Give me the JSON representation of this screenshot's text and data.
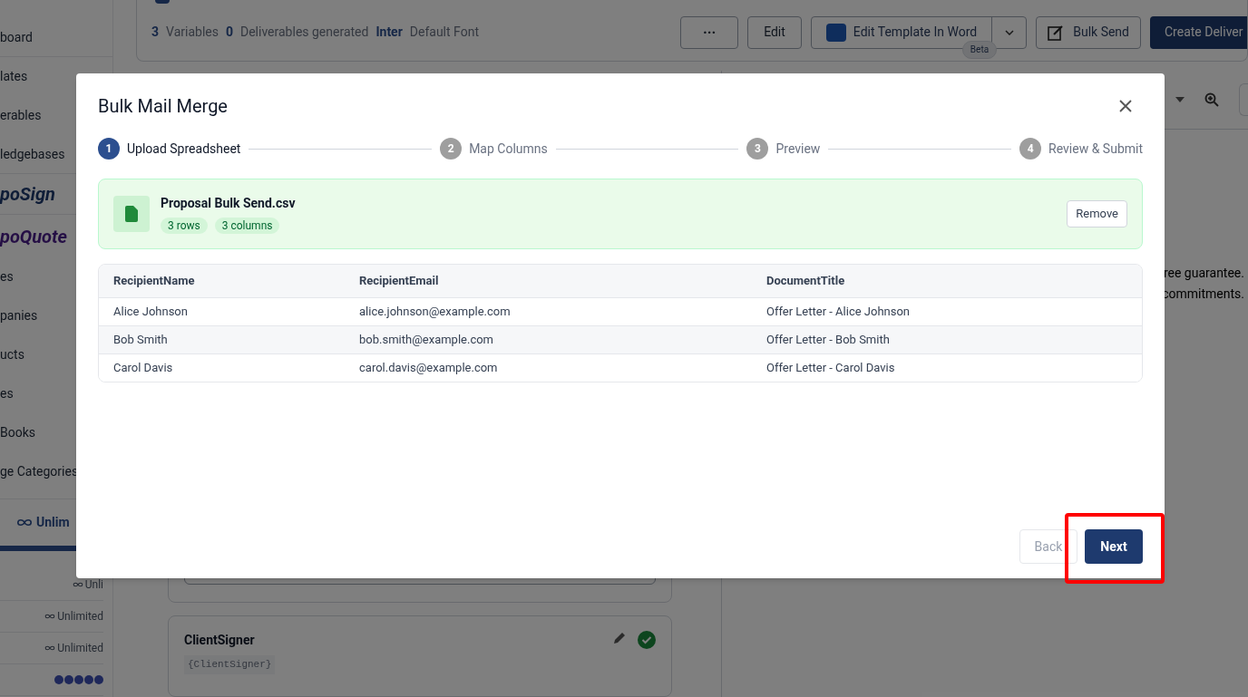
{
  "sidebar": {
    "items": [
      {
        "label": "board",
        "kind": "link"
      },
      {
        "label": "lates",
        "kind": "link"
      },
      {
        "label": "erables",
        "kind": "link"
      },
      {
        "label": "ledgebases",
        "kind": "link"
      },
      {
        "label": "poSign",
        "kind": "logo-sign"
      },
      {
        "label": "poQuote",
        "kind": "logo-quote"
      },
      {
        "label": "es",
        "kind": "link"
      },
      {
        "label": "panies",
        "kind": "link"
      },
      {
        "label": "ucts",
        "kind": "link"
      },
      {
        "label": "es",
        "kind": "link"
      },
      {
        "label": "Books",
        "kind": "link"
      },
      {
        "label": "ge Categories",
        "kind": "link"
      }
    ],
    "plan": {
      "label": "Unlim",
      "level": 1
    },
    "usage": [
      {
        "value": "Unli",
        "kind": "text"
      },
      {
        "value": "Unlimited",
        "kind": "text"
      },
      {
        "value": "Unlimited",
        "kind": "text"
      },
      {
        "kind": "dots"
      }
    ]
  },
  "header": {
    "stats": [
      {
        "number": "3",
        "label": "Variables"
      },
      {
        "number": "0",
        "label": "Deliverables generated"
      },
      {
        "number": "Inter",
        "label": "Default Font"
      }
    ],
    "buttons": [
      {
        "label": "···",
        "kind": "more"
      },
      {
        "label": "Edit",
        "kind": "plain"
      },
      {
        "label": "Edit Template In Word",
        "kind": "word",
        "badge": "Beta"
      },
      {
        "label": "Bulk Send",
        "kind": "bulk"
      },
      {
        "label": "Create Deliver",
        "kind": "primary"
      }
    ]
  },
  "variables": [
    {
      "name": "ClientSigner",
      "token": "{ClientSigner}",
      "verified": true
    }
  ],
  "preview": {
    "lines": [
      "ree guarantee.",
      "commitments."
    ]
  },
  "dialog": {
    "title": "Bulk Mail Merge",
    "steps": [
      {
        "number": "1",
        "label": "Upload Spreadsheet",
        "selected": true
      },
      {
        "number": "2",
        "label": "Map Columns",
        "selected": false
      },
      {
        "number": "3",
        "label": "Preview",
        "selected": false
      },
      {
        "number": "4",
        "label": "Review & Submit",
        "selected": false
      }
    ],
    "file": {
      "name": "Proposal Bulk Send.csv",
      "tags": [
        "3 rows",
        "3 columns"
      ],
      "action": "Remove"
    },
    "table": {
      "columns": [
        "RecipientName",
        "RecipientEmail",
        "DocumentTitle"
      ],
      "rows": [
        [
          "Alice Johnson",
          "alice.johnson@example.com",
          "Offer Letter - Alice Johnson"
        ],
        [
          "Bob Smith",
          "bob.smith@example.com",
          "Offer Letter - Bob Smith"
        ],
        [
          "Carol Davis",
          "carol.davis@example.com",
          "Offer Letter - Carol Davis"
        ]
      ]
    },
    "buttons": [
      {
        "label": "Back",
        "disabled": true,
        "kind": "secondary"
      },
      {
        "label": "Next",
        "disabled": false,
        "kind": "primary",
        "highlighted": true
      }
    ]
  }
}
